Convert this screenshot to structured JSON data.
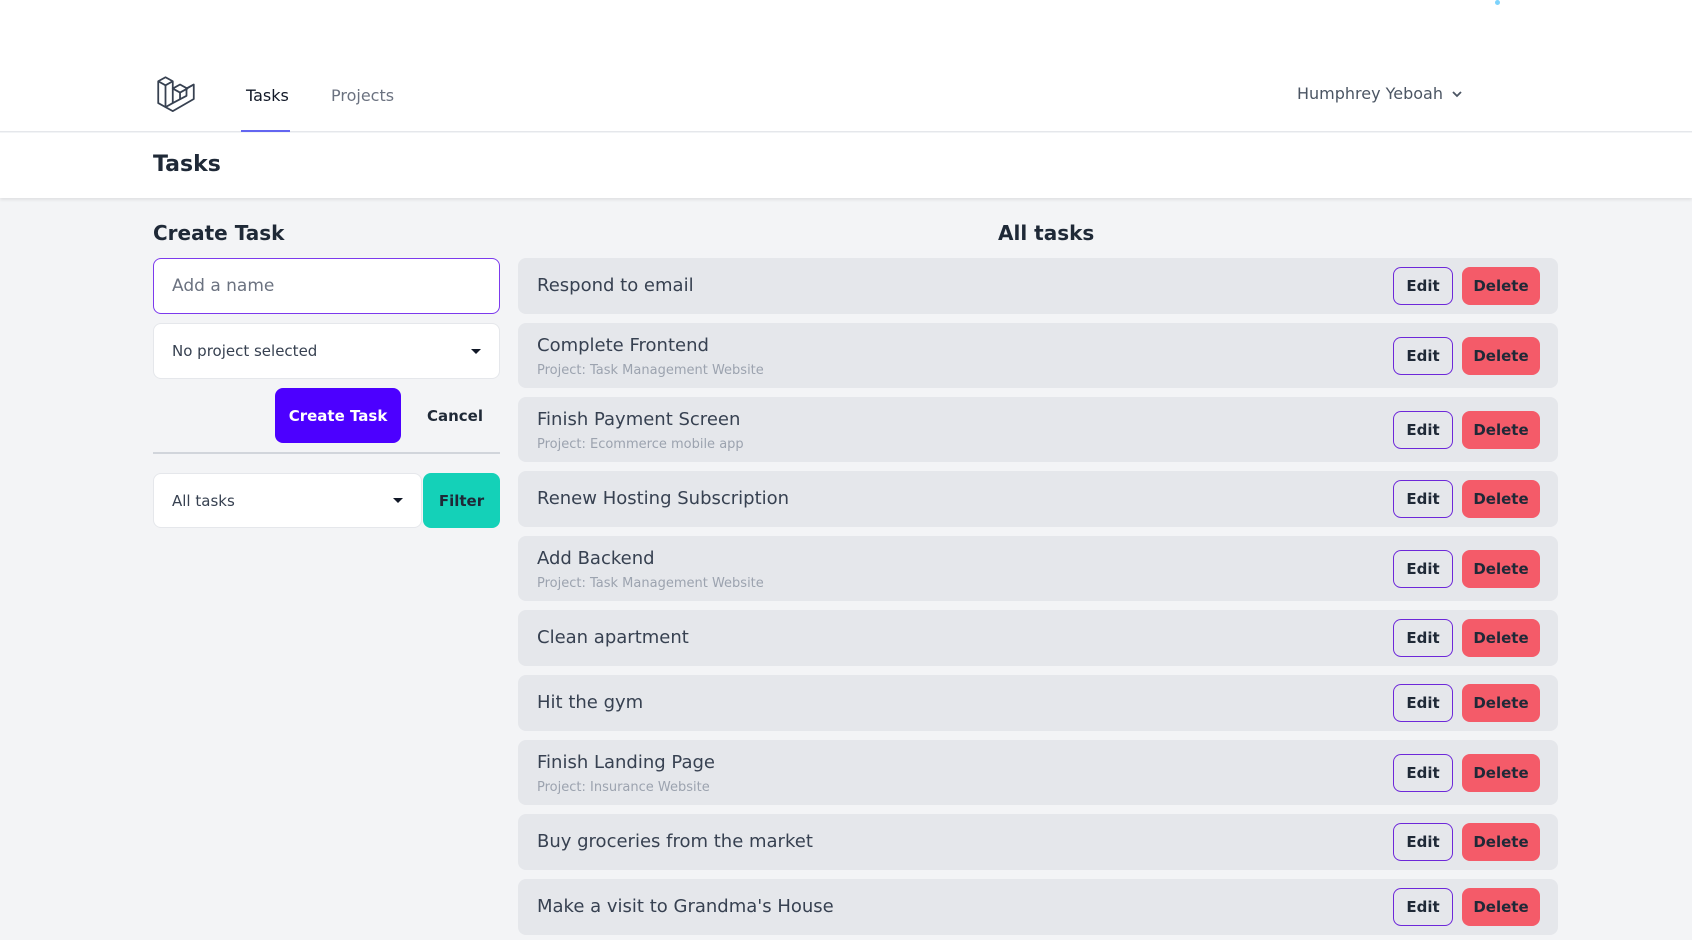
{
  "nav": {
    "tabs": [
      {
        "label": "Tasks",
        "active": true
      },
      {
        "label": "Projects",
        "active": false
      }
    ],
    "user_name": "Humphrey Yeboah",
    "logo_icon": "laravel-logo-icon"
  },
  "header": {
    "title": "Tasks"
  },
  "create_form": {
    "title": "Create Task",
    "name_placeholder": "Add a name",
    "project_select_value": "No project selected",
    "create_label": "Create Task",
    "cancel_label": "Cancel"
  },
  "filter": {
    "select_value": "All tasks",
    "button_label": "Filter"
  },
  "task_list": {
    "title": "All tasks",
    "edit_label": "Edit",
    "delete_label": "Delete",
    "tasks": [
      {
        "name": "Respond to email",
        "project": ""
      },
      {
        "name": "Complete Frontend",
        "project": "Project: Task Management Website"
      },
      {
        "name": "Finish Payment Screen",
        "project": "Project: Ecommerce mobile app"
      },
      {
        "name": "Renew Hosting Subscription",
        "project": ""
      },
      {
        "name": "Add Backend",
        "project": "Project: Task Management Website"
      },
      {
        "name": "Clean apartment",
        "project": ""
      },
      {
        "name": "Hit the gym",
        "project": ""
      },
      {
        "name": "Finish Landing Page",
        "project": "Project: Insurance Website"
      },
      {
        "name": "Buy groceries from the market",
        "project": ""
      },
      {
        "name": "Make a visit to Grandma's House",
        "project": ""
      }
    ]
  },
  "colors": {
    "primary": "#4c00ff",
    "filter": "#14d1b8",
    "delete": "#f45b69",
    "edit_border": "#6d28d9",
    "background": "#f3f4f6"
  }
}
